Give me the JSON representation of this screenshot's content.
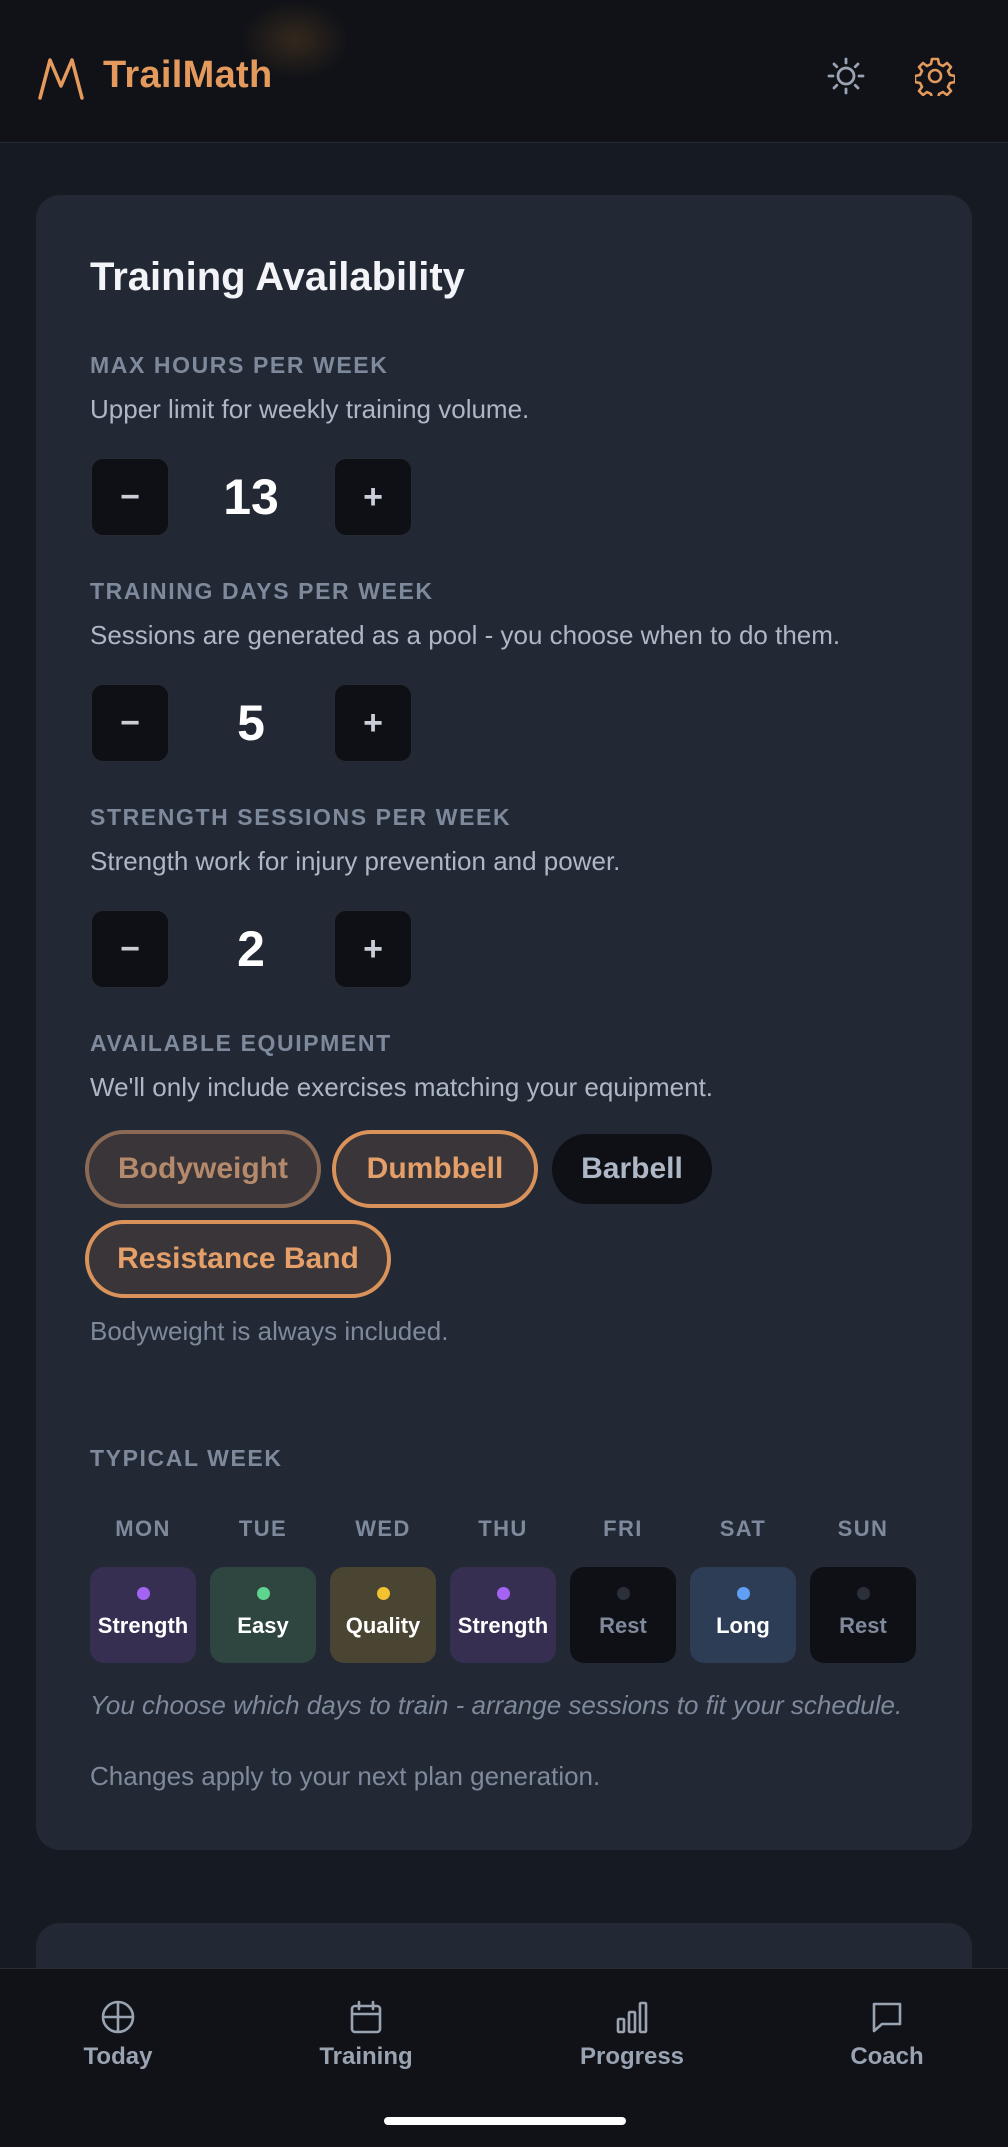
{
  "header": {
    "brand": "TrailMath",
    "logo_icon": "mountain-logo-icon",
    "theme_icon": "sun-icon",
    "settings_icon": "gear-icon",
    "accent_color": "#e39a5c"
  },
  "card": {
    "title": "Training Availability",
    "max_hours": {
      "label": "MAX HOURS PER WEEK",
      "description": "Upper limit for weekly training volume.",
      "value": "13",
      "decrement": "−",
      "increment": "+"
    },
    "training_days": {
      "label": "TRAINING DAYS PER WEEK",
      "description": "Sessions are generated as a pool - you choose when to do them.",
      "value": "5",
      "decrement": "−",
      "increment": "+"
    },
    "strength_sessions": {
      "label": "STRENGTH SESSIONS PER WEEK",
      "description": "Strength work for injury prevention and power.",
      "value": "2",
      "decrement": "−",
      "increment": "+"
    },
    "equipment": {
      "label": "AVAILABLE EQUIPMENT",
      "description": "We'll only include exercises matching your equipment.",
      "chips": [
        {
          "label": "Bodyweight",
          "selected": true,
          "locked": true
        },
        {
          "label": "Dumbbell",
          "selected": true
        },
        {
          "label": "Barbell",
          "selected": false
        },
        {
          "label": "Resistance Band",
          "selected": true
        }
      ],
      "note": "Bodyweight is always included."
    },
    "typical_week": {
      "label": "TYPICAL WEEK",
      "days": [
        {
          "day": "MON",
          "session": "Strength",
          "color": "#a463f2",
          "bg": "#362f52"
        },
        {
          "day": "TUE",
          "session": "Easy",
          "color": "#5fd48f",
          "bg": "#2e4540"
        },
        {
          "day": "WED",
          "session": "Quality",
          "color": "#f2c230",
          "bg": "#4a4433"
        },
        {
          "day": "THU",
          "session": "Strength",
          "color": "#a463f2",
          "bg": "#362f52"
        },
        {
          "day": "FRI",
          "session": "Rest",
          "color": "#2a2f3a",
          "bg": "#0e1015"
        },
        {
          "day": "SAT",
          "session": "Long",
          "color": "#5fa0f5",
          "bg": "#2c3d55"
        },
        {
          "day": "SUN",
          "session": "Rest",
          "color": "#2a2f3a",
          "bg": "#0e1015"
        }
      ],
      "note": "You choose which days to train - arrange sessions to fit your schedule."
    },
    "footer_note": "Changes apply to your next plan generation."
  },
  "nav": {
    "items": [
      {
        "label": "Today",
        "icon": "crosshair-icon"
      },
      {
        "label": "Training",
        "icon": "calendar-icon"
      },
      {
        "label": "Progress",
        "icon": "bar-chart-icon"
      },
      {
        "label": "Coach",
        "icon": "chat-bubble-icon"
      }
    ]
  }
}
